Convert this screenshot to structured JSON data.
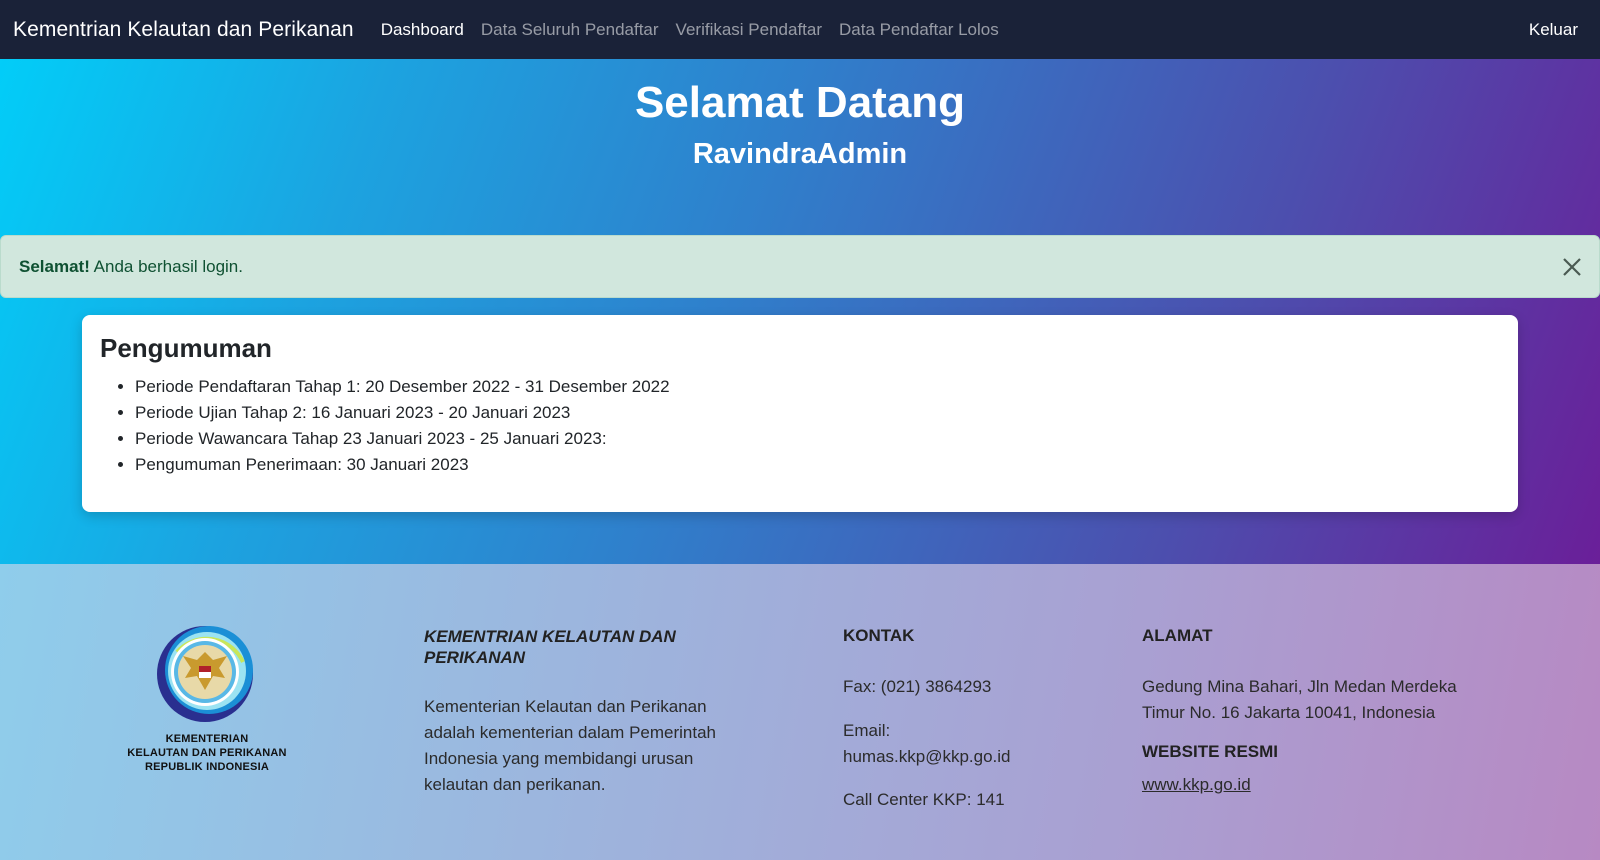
{
  "navbar": {
    "brand": "Kementrian Kelautan dan Perikanan",
    "items": [
      {
        "label": "Dashboard",
        "active": true
      },
      {
        "label": "Data Seluruh Pendaftar",
        "active": false
      },
      {
        "label": "Verifikasi Pendaftar",
        "active": false
      },
      {
        "label": "Data Pendaftar Lolos",
        "active": false
      }
    ],
    "logout_label": "Keluar"
  },
  "hero": {
    "title": "Selamat Datang",
    "username": "RavindraAdmin"
  },
  "alert": {
    "strong": "Selamat!",
    "message": " Anda berhasil login."
  },
  "announcement": {
    "title": "Pengumuman",
    "items": [
      "Periode Pendaftaran Tahap 1: 20 Desember 2022 - 31 Desember 2022",
      "Periode Ujian Tahap 2: 16 Januari 2023 - 20 Januari 2023",
      "Periode Wawancara Tahap 23 Januari 2023 - 25 Januari 2023:",
      "Pengumuman Penerimaan: 30 Januari 2023"
    ]
  },
  "footer": {
    "logo_text": [
      "KEMENTERIAN",
      "KELAUTAN DAN PERIKANAN",
      "REPUBLIK INDONESIA"
    ],
    "about": {
      "title_line1": "KEMENTRIAN KELAUTAN DAN",
      "title_line2": "PERIKANAN",
      "lines": [
        "Kementerian Kelautan dan Perikanan",
        "adalah kementerian dalam Pemerintah",
        "Indonesia yang membidangi urusan",
        "kelautan dan perikanan."
      ]
    },
    "contact": {
      "title": "KONTAK",
      "fax": "Fax: (021) 3864293",
      "email_label": "Email:",
      "email": "humas.kkp@kkp.go.id",
      "call_center": "Call Center KKP: 141"
    },
    "address": {
      "title": "ALAMAT",
      "line1": "Gedung Mina Bahari, Jln Medan Merdeka",
      "line2": "Timur No. 16 Jakarta 10041, Indonesia",
      "website_title": "WEBSITE RESMI",
      "website": "www.kkp.go.id"
    }
  },
  "colors": {
    "navbar_bg": "#1a2238",
    "alert_bg": "#d1e7dd",
    "alert_text": "#0f5132"
  }
}
